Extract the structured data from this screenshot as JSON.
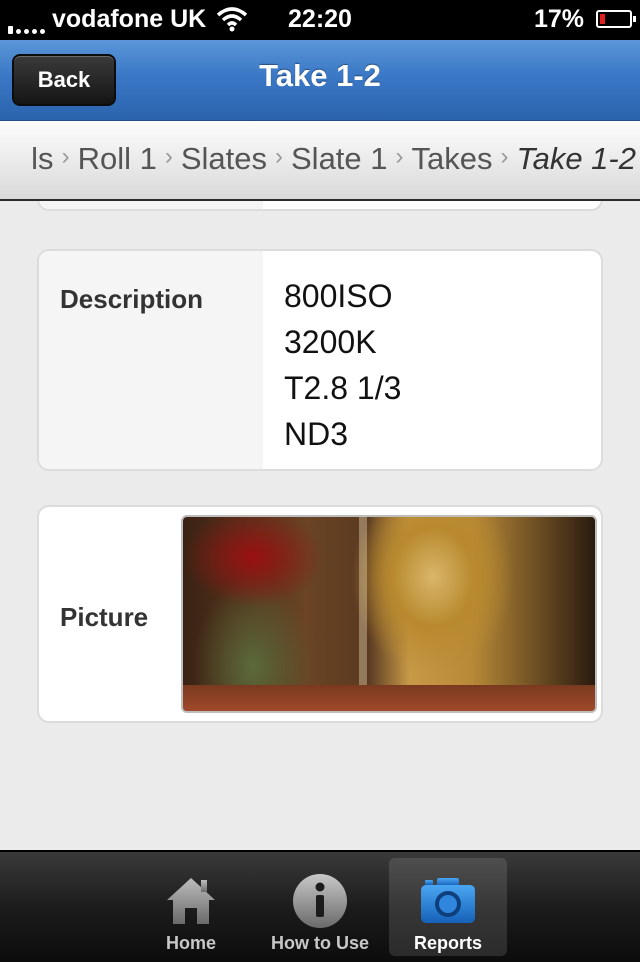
{
  "status_bar": {
    "carrier": "vodafone UK",
    "time": "22:20",
    "battery_percent": "17%",
    "battery_level": 0.17
  },
  "nav": {
    "title": "Take 1-2",
    "back_label": "Back"
  },
  "breadcrumb": {
    "items": [
      "ls",
      "Roll 1",
      "Slates",
      "Slate 1",
      "Takes",
      "Take 1-2"
    ]
  },
  "description": {
    "label": "Description",
    "lines": [
      "800ISO",
      "3200K",
      "T2.8 1/3",
      "ND3"
    ]
  },
  "picture": {
    "label": "Picture"
  },
  "tabbar": {
    "tabs": [
      {
        "label": "Home",
        "icon": "home-icon"
      },
      {
        "label": "How to Use",
        "icon": "info-icon"
      },
      {
        "label": "Reports",
        "icon": "camera-icon",
        "active": true
      }
    ]
  },
  "colors": {
    "nav_blue": "#3a78c6",
    "active_icon": "#1e7ad8",
    "battery_low": "#e02020"
  }
}
